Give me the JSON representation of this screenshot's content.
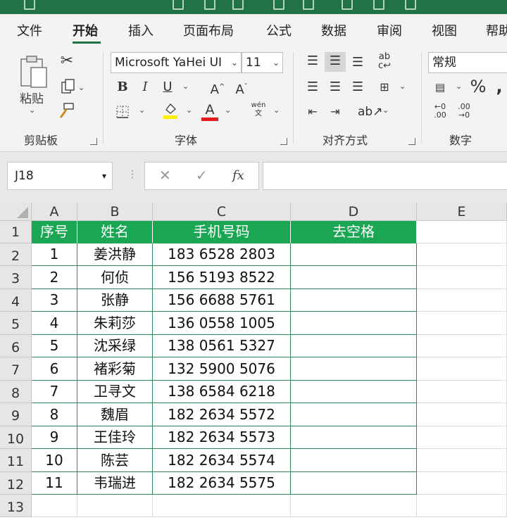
{
  "ribbon_tabs": [
    "文件",
    "开始",
    "插入",
    "页面布局",
    "公式",
    "数据",
    "审阅",
    "视图",
    "帮助"
  ],
  "active_tab": "开始",
  "clipboard": {
    "paste_label": "粘贴",
    "group_label": "剪贴板"
  },
  "font": {
    "name": "Microsoft YaHei UI",
    "size": "11",
    "group_label": "字体",
    "bold": "B",
    "italic": "I",
    "underline": "U",
    "grow": "A",
    "shrink": "A",
    "phonetic": "wén",
    "font_color_glyph": "A"
  },
  "alignment": {
    "group_label": "对齐方式"
  },
  "number": {
    "format": "常规",
    "group_label": "数字",
    "percent": "%"
  },
  "formula_bar": {
    "name_box": "J18",
    "fx": "fx"
  },
  "columns": [
    "A",
    "B",
    "C",
    "D",
    "E"
  ],
  "rows": [
    "1",
    "2",
    "3",
    "4",
    "5",
    "6",
    "7",
    "8",
    "9",
    "10",
    "11",
    "12",
    "13"
  ],
  "table": {
    "headers": [
      "序号",
      "姓名",
      "手机号码",
      "去空格"
    ],
    "rows": [
      [
        "1",
        "姜洪静",
        "183 6528 2803",
        ""
      ],
      [
        "2",
        "何侦",
        "156 5193 8522",
        ""
      ],
      [
        "3",
        "张静",
        "156 6688 5761",
        ""
      ],
      [
        "4",
        "朱莉莎",
        "136 0558 1005",
        ""
      ],
      [
        "5",
        "沈采绿",
        "138 0561 5327",
        ""
      ],
      [
        "6",
        "褚彩菊",
        "132 5900 5076",
        ""
      ],
      [
        "7",
        "卫寻文",
        "138 6584 6218",
        ""
      ],
      [
        "8",
        "魏眉",
        "182 2634 5572",
        ""
      ],
      [
        "9",
        "王佳玲",
        "182 2634 5573",
        ""
      ],
      [
        "10",
        "陈芸",
        "182 2634 5574",
        ""
      ],
      [
        "11",
        "韦瑞进",
        "182 2634 5575",
        ""
      ]
    ]
  },
  "colors": {
    "title_bar": "#217346",
    "table_header": "#1aa653",
    "table_border": "#2e8b57"
  }
}
